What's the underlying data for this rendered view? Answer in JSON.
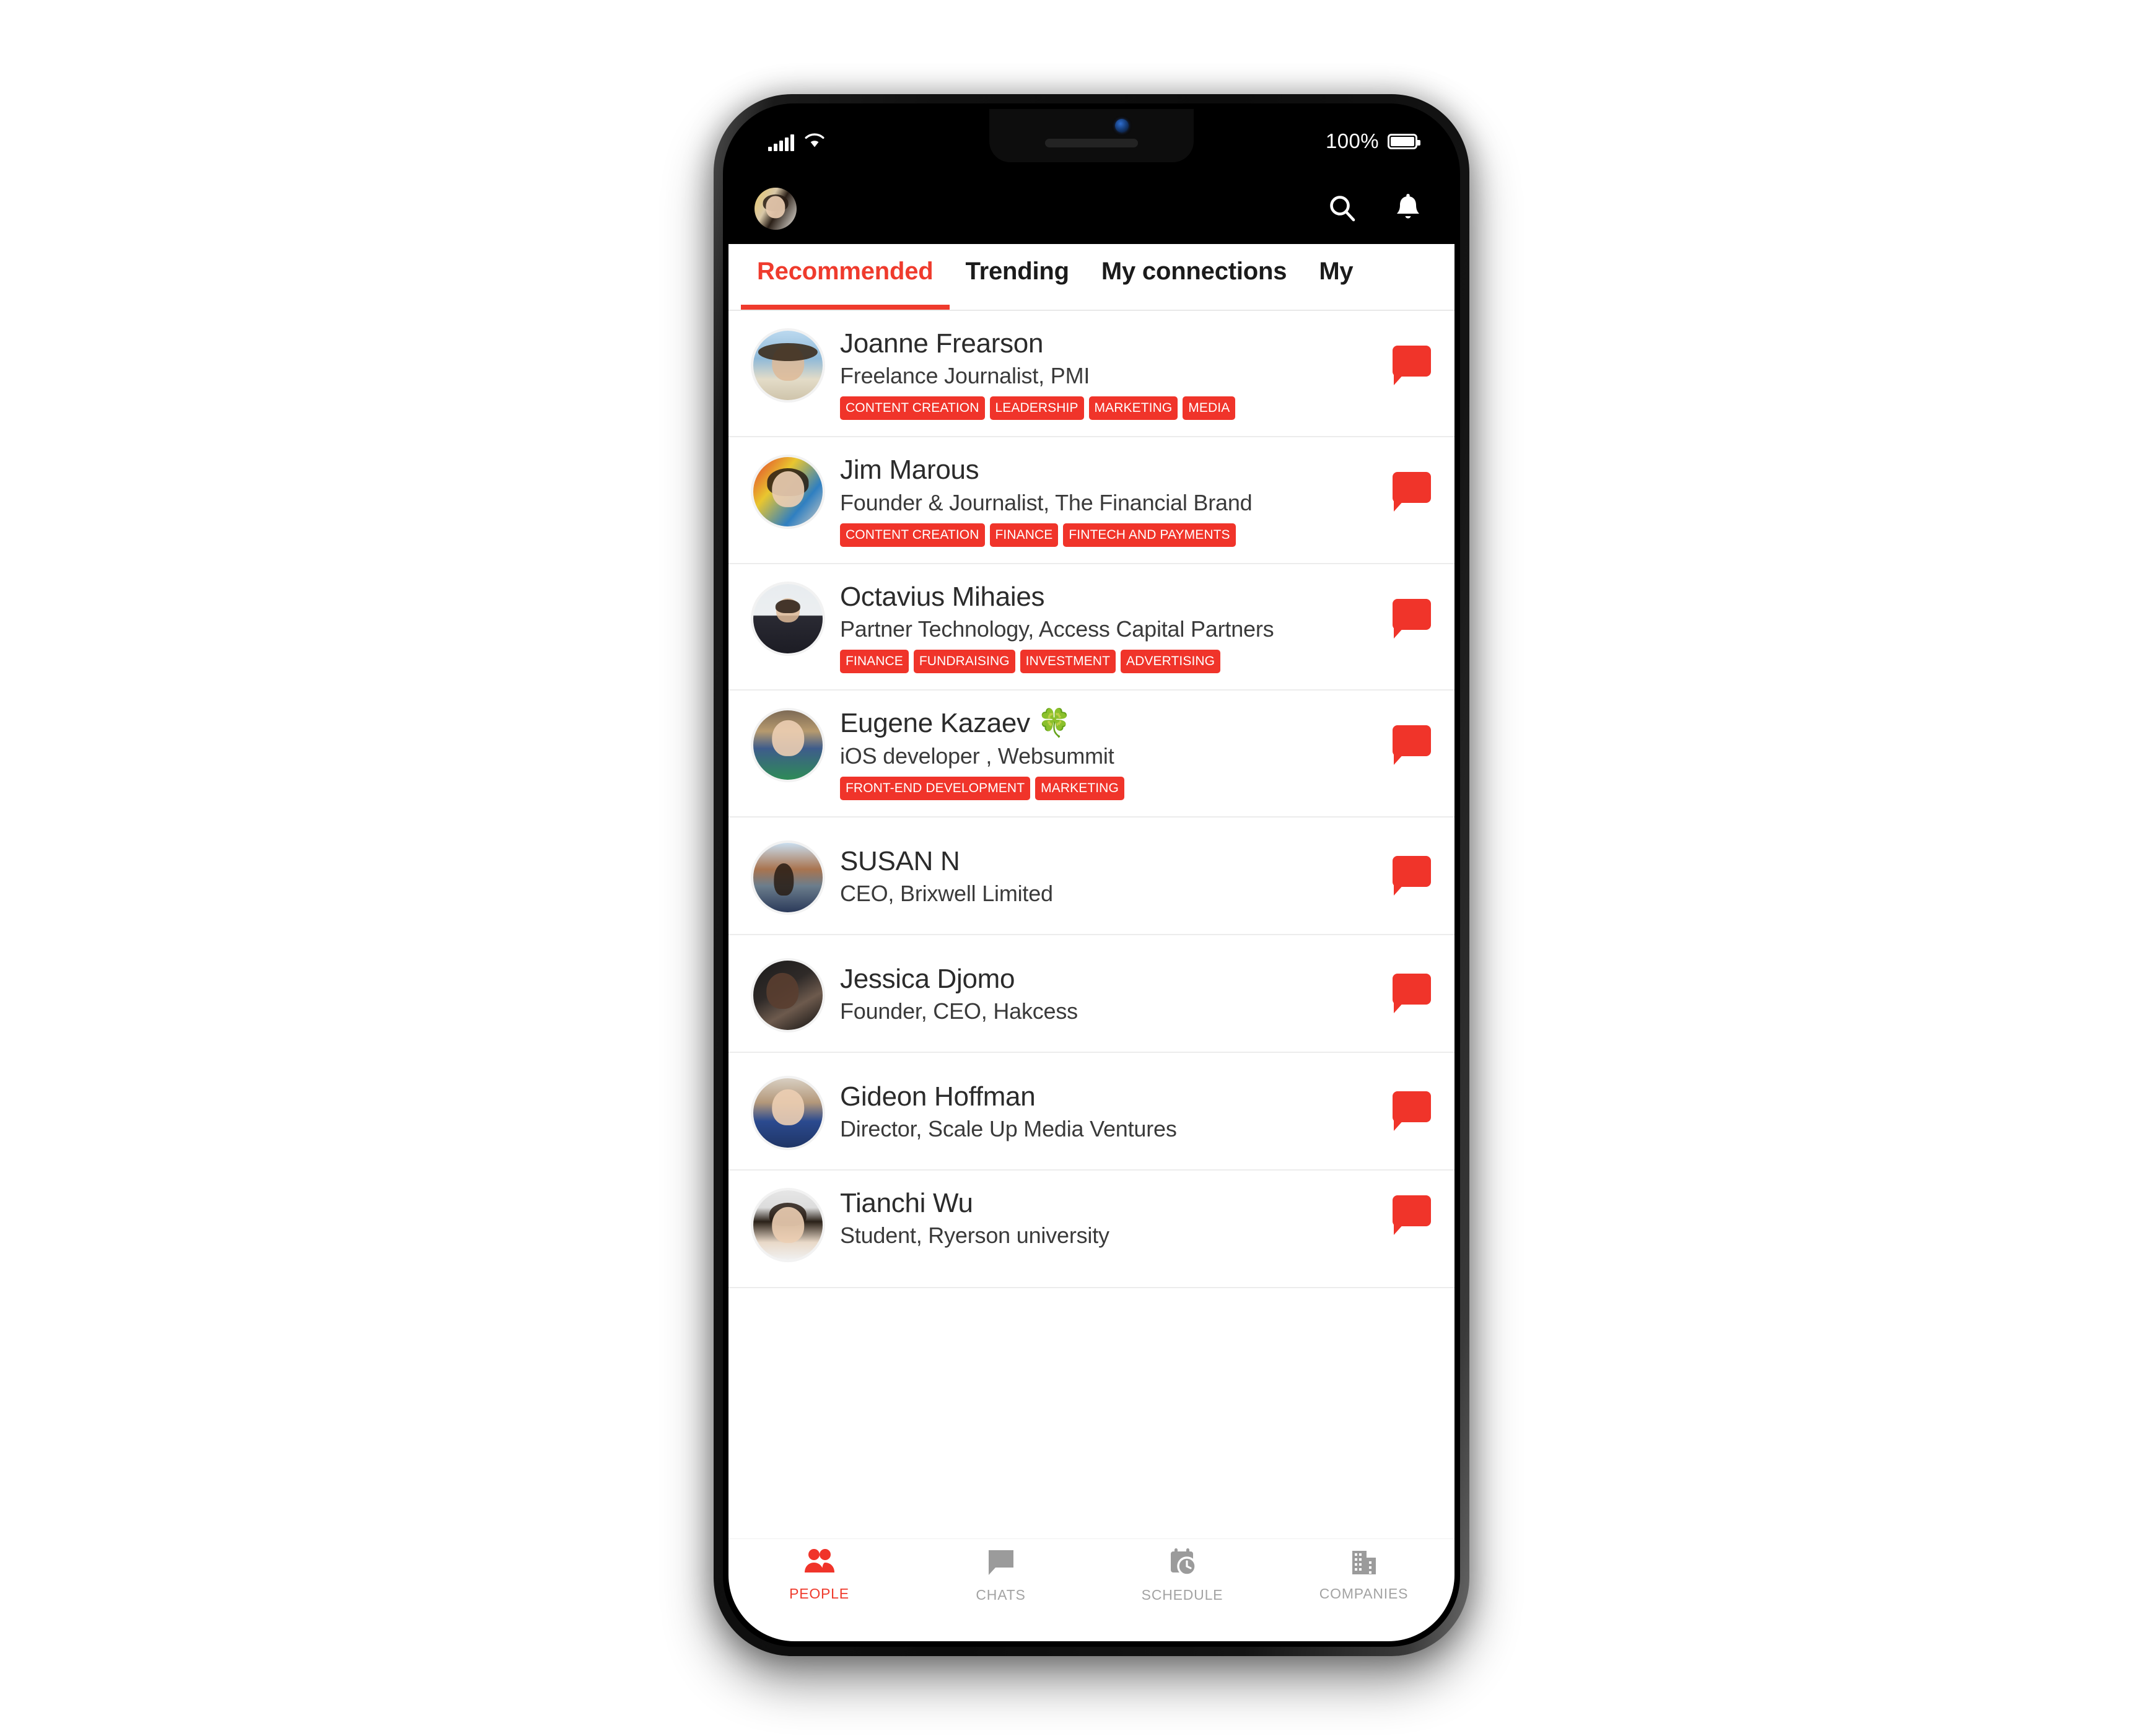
{
  "status_bar": {
    "battery_percent": "100%",
    "signal_icon": "signal-bars-icon",
    "wifi_icon": "wifi-icon",
    "battery_icon": "battery-full-icon"
  },
  "header": {
    "avatar_name": "my-profile-avatar",
    "search_icon": "search-icon",
    "notifications_icon": "bell-icon"
  },
  "tabs": [
    {
      "label": "Recommended",
      "active": true
    },
    {
      "label": "Trending",
      "active": false
    },
    {
      "label": "My connections",
      "active": false
    },
    {
      "label": "My",
      "active": false
    }
  ],
  "people": [
    {
      "name": "Joanne Frearson",
      "title": "Freelance Journalist, PMI",
      "tags": [
        "CONTENT CREATION",
        "LEADERSHIP",
        "MARKETING",
        "MEDIA"
      ],
      "avatar_style": "ph-beach"
    },
    {
      "name": "Jim Marous",
      "title": "Founder & Journalist, The Financial Brand",
      "tags": [
        "CONTENT CREATION",
        "FINANCE",
        "FINTECH AND PAYMENTS"
      ],
      "avatar_style": "ph-art"
    },
    {
      "name": "Octavius Mihaies",
      "title": "Partner Technology, Access Capital Partners",
      "tags": [
        "FINANCE",
        "FUNDRAISING",
        "INVESTMENT",
        "ADVERTISING"
      ],
      "avatar_style": "ph-suit"
    },
    {
      "name": "Eugene Kazaev 🍀",
      "title": "iOS developer , Websummit",
      "tags": [
        "FRONT-END DEVELOPMENT",
        "MARKETING"
      ],
      "avatar_style": "ph-mask"
    },
    {
      "name": "SUSAN N",
      "title": "CEO, Brixwell Limited",
      "tags": [],
      "avatar_style": "ph-city"
    },
    {
      "name": "Jessica Djomo",
      "title": "Founder, CEO, Hakcess",
      "tags": [],
      "avatar_style": "ph-dark"
    },
    {
      "name": "Gideon Hoffman",
      "title": "Director, Scale Up Media Ventures",
      "tags": [],
      "avatar_style": "ph-office"
    },
    {
      "name": "Tianchi Wu",
      "title": "Student, Ryerson university",
      "tags": [],
      "avatar_style": "ph-asian"
    }
  ],
  "message_button_label": "message-bubble",
  "bottom_nav": [
    {
      "label": "PEOPLE",
      "icon": "people-icon",
      "active": true
    },
    {
      "label": "CHATS",
      "icon": "chat-bubble-icon",
      "active": false
    },
    {
      "label": "SCHEDULE",
      "icon": "calendar-clock-icon",
      "active": false
    },
    {
      "label": "COMPANIES",
      "icon": "building-icon",
      "active": false
    }
  ],
  "colors": {
    "accent": "#ef3b2d",
    "tag": "#f0342a",
    "nav_inactive": "#a3a3a3",
    "text_primary": "#2b2b2b"
  }
}
